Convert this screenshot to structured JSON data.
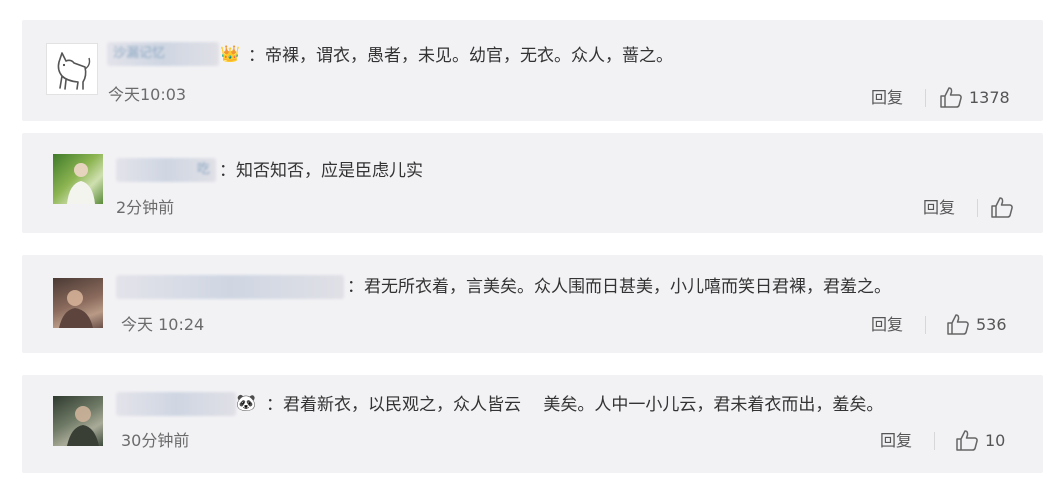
{
  "comments": [
    {
      "username": "沙漏记忆",
      "emoji": "👑",
      "text": "：帝裸，谓衣，愚者，未见。幼官，无衣。众人，蔷之。",
      "time": "今天10:03",
      "reply_label": "回复",
      "likes": "1378"
    },
    {
      "username": "吃",
      "emoji": "",
      "text": "：知否知否，应是臣虑儿实",
      "time": "2分钟前",
      "reply_label": "回复",
      "likes": ""
    },
    {
      "username": "",
      "emoji": "",
      "text": "：君无所衣着，言美矣。众人围而日甚美，小儿嘻而笑日君裸，君羞之。",
      "time": "今天 10:24",
      "reply_label": "回复",
      "likes": "536"
    },
    {
      "username": "",
      "emoji": "🐼",
      "text": "：君着新衣，以民观之，众人皆云 　美矣。人中一小儿云，君未着衣而出，羞矣。",
      "time": "30分钟前",
      "reply_label": "回复",
      "likes": "10"
    }
  ]
}
